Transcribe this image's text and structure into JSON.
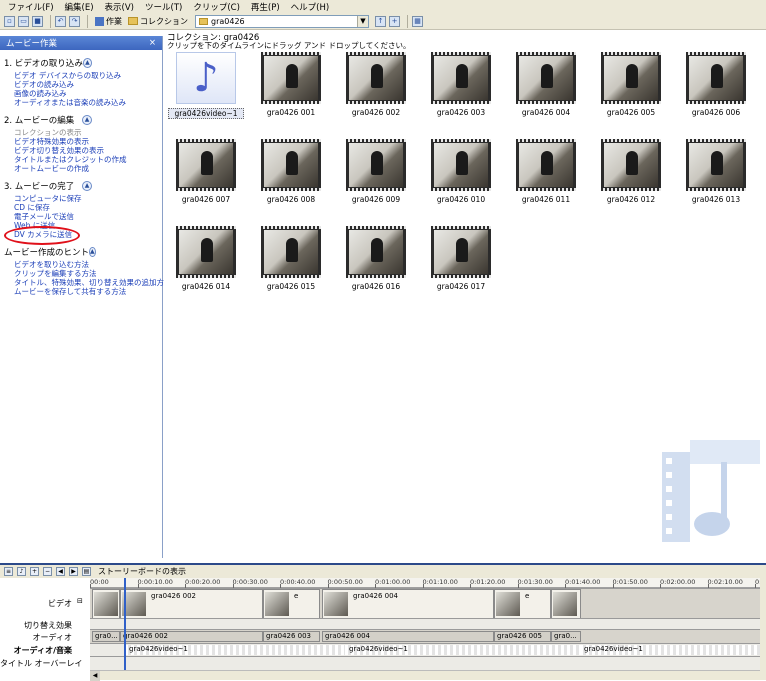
{
  "menu": [
    "ファイル(F)",
    "編集(E)",
    "表示(V)",
    "ツール(T)",
    "クリップ(C)",
    "再生(P)",
    "ヘルプ(H)"
  ],
  "toolbar": {
    "tasks_label": "作業",
    "collections_label": "コレクション",
    "collection_value": "gra0426"
  },
  "tasks": {
    "header": "ムービー作業",
    "close": "×",
    "sections": [
      {
        "title": "1. ビデオの取り込み",
        "items": [
          {
            "label": "ビデオ デバイスからの取り込み",
            "disabled": false
          },
          {
            "label": "ビデオの読み込み",
            "disabled": false
          },
          {
            "label": "画像の読み込み",
            "disabled": false
          },
          {
            "label": "オーディオまたは音楽の読み込み",
            "disabled": false
          }
        ]
      },
      {
        "title": "2. ムービーの編集",
        "items": [
          {
            "label": "コレクションの表示",
            "disabled": true
          },
          {
            "label": "ビデオ特殊効果の表示",
            "disabled": false
          },
          {
            "label": "ビデオ切り替え効果の表示",
            "disabled": false
          },
          {
            "label": "タイトルまたはクレジットの作成",
            "disabled": false
          },
          {
            "label": "オートムービーの作成",
            "disabled": false
          }
        ]
      },
      {
        "title": "3. ムービーの完了",
        "items": [
          {
            "label": "コンピュータに保存",
            "disabled": false
          },
          {
            "label": "CD に保存",
            "disabled": false
          },
          {
            "label": "電子メールで送信",
            "disabled": false
          },
          {
            "label": "Web に送信",
            "disabled": false
          },
          {
            "label": "DV カメラに送信",
            "disabled": false
          }
        ]
      },
      {
        "title": "ムービー作成のヒント",
        "items": [
          {
            "label": "ビデオを取り込む方法",
            "disabled": false
          },
          {
            "label": "クリップを編集する方法",
            "disabled": false
          },
          {
            "label": "タイトル、特殊効果、切り替え効果の追加方法",
            "disabled": false
          },
          {
            "label": "ムービーを保存して共有する方法",
            "disabled": false
          }
        ]
      }
    ]
  },
  "collection": {
    "title": "コレクション: gra0426",
    "subtitle": "クリップを下のタイムラインにドラッグ アンド ドロップしてください。",
    "clips": [
      {
        "label": "gra0426video~1",
        "kind": "audio",
        "selected": true
      },
      {
        "label": "gra0426 001",
        "kind": "video",
        "selected": false
      },
      {
        "label": "gra0426 002",
        "kind": "video",
        "selected": false
      },
      {
        "label": "gra0426 003",
        "kind": "video",
        "selected": false
      },
      {
        "label": "gra0426 004",
        "kind": "video",
        "selected": false
      },
      {
        "label": "gra0426 005",
        "kind": "video",
        "selected": false
      },
      {
        "label": "gra0426 006",
        "kind": "video",
        "selected": false
      },
      {
        "label": "gra0426 007",
        "kind": "video",
        "selected": false
      },
      {
        "label": "gra0426 008",
        "kind": "video",
        "selected": false
      },
      {
        "label": "gra0426 009",
        "kind": "video",
        "selected": false
      },
      {
        "label": "gra0426 010",
        "kind": "video",
        "selected": false
      },
      {
        "label": "gra0426 011",
        "kind": "video",
        "selected": false
      },
      {
        "label": "gra0426 012",
        "kind": "video",
        "selected": false
      },
      {
        "label": "gra0426 013",
        "kind": "video",
        "selected": false
      },
      {
        "label": "gra0426 014",
        "kind": "video",
        "selected": false
      },
      {
        "label": "gra0426 015",
        "kind": "video",
        "selected": false
      },
      {
        "label": "gra0426 016",
        "kind": "video",
        "selected": false
      },
      {
        "label": "gra0426 017",
        "kind": "video",
        "selected": false
      }
    ]
  },
  "timeline": {
    "storyboard_label": "ストーリーボードの表示",
    "ticks": [
      "00:00",
      "0:00:10.00",
      "0:00:20.00",
      "0:00:30.00",
      "0:00:40.00",
      "0:00:50.00",
      "0:01:00.00",
      "0:01:10.00",
      "0:01:20.00",
      "0:01:30.00",
      "0:01:40.00",
      "0:01:50.00",
      "0:02:00.00",
      "0:02:10.00",
      "0:02:2"
    ],
    "tracks": {
      "video": "ビデオ",
      "transition": "切り替え効果",
      "audio": "オーディオ",
      "music": "オーディオ/音楽",
      "title_overlay": "タイトル オーバーレイ"
    },
    "video_clips": [
      "",
      "gra0426 002",
      "e",
      "gra0426 004",
      "e",
      ""
    ],
    "audio_clips": [
      "gra0...",
      "gra0426 002",
      "gra0426 003",
      "gra0426 004",
      "gra0426 005",
      "gra0..."
    ],
    "music_clips": [
      "gra0426video~1",
      "gra0426video~1",
      "gra0426video~1"
    ]
  }
}
